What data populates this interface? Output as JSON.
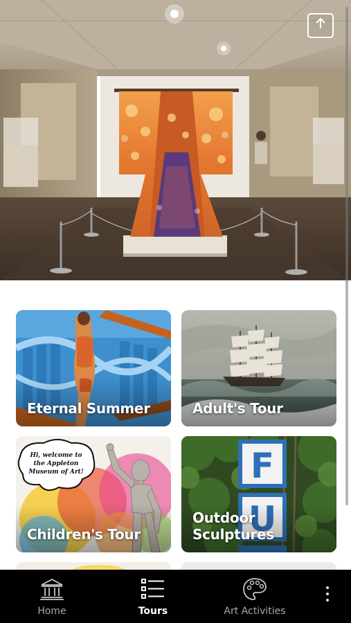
{
  "hero": {
    "image": "museum gallery with kimono on display",
    "share_icon": "share-icon"
  },
  "tours": [
    {
      "title": "Eternal Summer",
      "image": "collage swimsuit figure"
    },
    {
      "title": "Adult's Tour",
      "image": "sailing ship in stormy sea painting"
    },
    {
      "title": "Children's Tour",
      "image": "wooden mannequin with speech bubble",
      "bubble_text": "Hi, welcome to the Appleton Museum of Art!"
    },
    {
      "title": "Outdoor Sculptures",
      "image": "letter sculptures in trees",
      "sign_letters": [
        "F",
        "U"
      ]
    },
    {
      "title": "",
      "image": "partially visible card"
    },
    {
      "title": "",
      "image": "partially visible card"
    }
  ],
  "nav": {
    "items": [
      {
        "label": "Home",
        "icon": "museum-icon",
        "active": false
      },
      {
        "label": "Tours",
        "icon": "list-icon",
        "active": true
      },
      {
        "label": "Art Activities",
        "icon": "palette-icon",
        "active": false
      }
    ],
    "more_icon": "more-vertical-icon"
  },
  "colors": {
    "nav_background": "#000000",
    "nav_active": "#ffffff",
    "nav_inactive": "#a9a9a9"
  }
}
